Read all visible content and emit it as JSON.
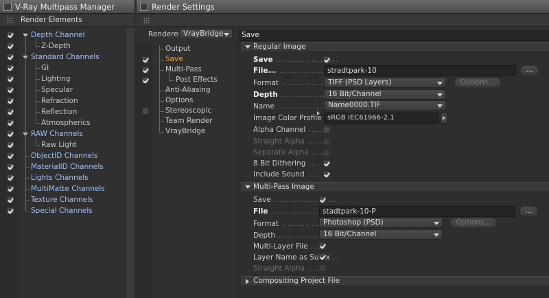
{
  "left_window": {
    "title": "V-Ray Multipass Manager",
    "header": "Render Elements",
    "items": [
      {
        "label": "Depth Channel",
        "checked": true,
        "level": 0,
        "expanded": true
      },
      {
        "label": "Z-Depth",
        "checked": true,
        "level": 1
      },
      {
        "label": "Standard Channels",
        "checked": true,
        "level": 0,
        "expanded": true
      },
      {
        "label": "GI",
        "checked": true,
        "level": 1
      },
      {
        "label": "Lighting",
        "checked": true,
        "level": 1
      },
      {
        "label": "Specular",
        "checked": true,
        "level": 1
      },
      {
        "label": "Refraction",
        "checked": true,
        "level": 1
      },
      {
        "label": "Reflection",
        "checked": true,
        "level": 1
      },
      {
        "label": "Atmospherics",
        "checked": true,
        "level": 1
      },
      {
        "label": "RAW Channels",
        "checked": true,
        "level": 0,
        "expanded": true
      },
      {
        "label": "Raw Light",
        "checked": true,
        "level": 1
      },
      {
        "label": "ObjectID Channels",
        "checked": true,
        "level": 0
      },
      {
        "label": "MaterialID Channels",
        "checked": true,
        "level": 0
      },
      {
        "label": "Lights Channels",
        "checked": true,
        "level": 0
      },
      {
        "label": "MultiMatte Channels",
        "checked": true,
        "level": 0
      },
      {
        "label": "Texture Channels",
        "checked": true,
        "level": 0
      },
      {
        "label": "Special Channels",
        "checked": true,
        "level": 0
      }
    ]
  },
  "render_settings": {
    "title": "Render Settings",
    "renderer_label": "Renderer",
    "renderer_value": "VrayBridge",
    "panel_title": "Save",
    "nav": [
      {
        "label": "Output",
        "checkbox": false,
        "checked": false,
        "indent": 0,
        "active": false
      },
      {
        "label": "Save",
        "checkbox": true,
        "checked": true,
        "indent": 0,
        "active": true
      },
      {
        "label": "Multi-Pass",
        "checkbox": true,
        "checked": true,
        "indent": 0,
        "active": false
      },
      {
        "label": "Post Effects",
        "checkbox": true,
        "checked": true,
        "indent": 1,
        "active": false
      },
      {
        "label": "Anti-Aliasing",
        "checkbox": false,
        "checked": false,
        "indent": 0,
        "active": false
      },
      {
        "label": "Options",
        "checkbox": false,
        "checked": false,
        "indent": 0,
        "active": false
      },
      {
        "label": "Stereoscopic",
        "checkbox": true,
        "checked": false,
        "indent": 0,
        "active": false
      },
      {
        "label": "Team Render",
        "checkbox": false,
        "checked": false,
        "indent": 0,
        "active": false
      },
      {
        "label": "VrayBridge",
        "checkbox": false,
        "checked": false,
        "indent": 0,
        "active": false
      }
    ],
    "regular_image": {
      "title": "Regular Image",
      "save_label": "Save",
      "save_checked": true,
      "file_label": "File...",
      "file_value": "stradtpark-10",
      "browse_label": "...",
      "format_label": "Format",
      "format_value": "TIFF (PSD Layers)",
      "options_label": "Options...",
      "depth_label": "Depth",
      "depth_value": "16 Bit/Channel",
      "name_label": "Name",
      "name_value": "Name0000.TIF",
      "profile_label": "Image Color Profile",
      "profile_value": "sRGB IEC61966-2.1",
      "alpha_label": "Alpha Channel",
      "straight_alpha_label": "Straight Alpha",
      "separate_alpha_label": "Separate Alpha",
      "dithering_label": "8 Bit Dithering",
      "dithering_checked": true,
      "sound_label": "Include Sound",
      "sound_checked": true
    },
    "multipass_image": {
      "title": "Multi-Pass Image",
      "save_label": "Save",
      "save_checked": true,
      "file_label": "File",
      "file_value": "stadtpark-10-P",
      "browse_label": "...",
      "format_label": "Format",
      "format_value": "Photoshop (PSD)",
      "options_label": "Options...",
      "depth_label": "Depth",
      "depth_value": "16 Bit/Channel",
      "multilayer_label": "Multi-Layer File",
      "multilayer_checked": true,
      "layername_label": "Layer Name as Suffix",
      "layername_checked": true,
      "straight_alpha_label": "Straight Alpha"
    },
    "compositing": {
      "title": "Compositing Project File"
    }
  }
}
